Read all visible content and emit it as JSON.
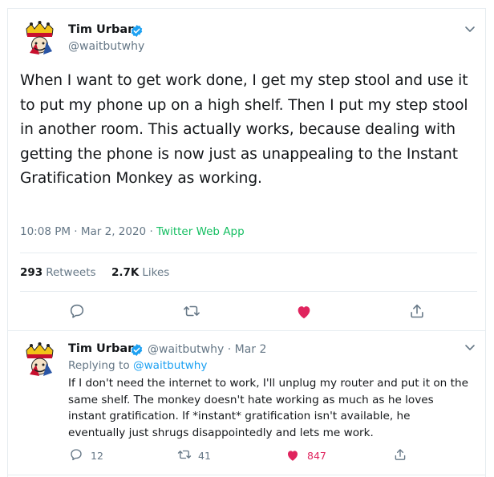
{
  "main_tweet": {
    "author_name": "Tim Urban",
    "author_handle": "@waitbutwhy",
    "text": "When I want to get work done, I get my step stool and use it to put my phone up on a high shelf. Then I put my step stool in another room. This actually works, because dealing with getting the phone is now just as unappealing to the Instant Gratification Monkey as working.",
    "timestamp": "10:08 PM · Mar 2, 2020 · ",
    "source": "Twitter Web App",
    "retweets_count": "293",
    "retweets_label": "Retweets",
    "likes_count": "2.7K",
    "likes_label": "Likes"
  },
  "reply_tweet": {
    "author_name": "Tim Urban",
    "author_handle": "@waitbutwhy · Mar 2",
    "replying_prefix": "Replying to ",
    "replying_to": "@waitbutwhy",
    "text": "If I don't need the internet to work, I'll unplug my router and put it on the same shelf. The monkey doesn't hate working as much as he loves instant gratification. If *instant* gratification isn't available, he eventually just shrugs disappointedly and lets me work.",
    "reply_count": "12",
    "retweet_count": "41",
    "like_count": "847"
  },
  "colors": {
    "verified": "#1da1f2",
    "like": "#e0245e",
    "muted": "#657786",
    "source": "#17bf63"
  },
  "icons": [
    "verified-badge-icon",
    "chevron-down-icon",
    "reply-icon",
    "retweet-icon",
    "heart-icon",
    "share-icon"
  ]
}
